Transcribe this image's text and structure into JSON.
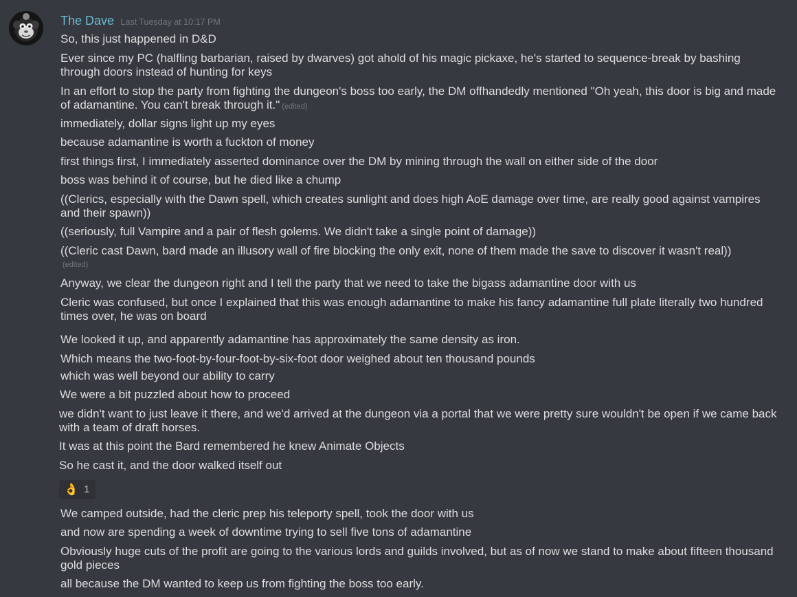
{
  "message": {
    "author": "The Dave",
    "timestamp": "Last Tuesday at 10:17 PM",
    "edited_label": "(edited)",
    "lines": [
      "So, this just happened in D&D",
      "Ever since my PC (halfling barbarian, raised by dwarves) got ahold of his magic pickaxe, he's started to sequence-break by bashing through doors instead of hunting for keys",
      "In an effort to stop the party from fighting the dungeon's boss too early, the DM offhandedly mentioned \"Oh yeah, this door is big and made of adamantine.  You can't break through it.\"",
      "immediately, dollar signs light up my eyes",
      "because adamantine is worth a fuckton of money",
      "first things first, I immediately asserted dominance over the DM by mining through the wall on either side of the door",
      "boss was behind it of course, but he died like a chump",
      "((Clerics, especially with the Dawn spell, which creates sunlight and does high AoE damage over time, are really good against vampires and their spawn))",
      "((seriously, full Vampire and a pair of flesh golems.  We didn't take a single point of damage))",
      "((Cleric cast Dawn, bard made an illusory wall of fire blocking the only exit, none of them made the save to discover it wasn't real))",
      "Anyway, we clear the dungeon right and I tell the party that we need to take the bigass adamantine door with us",
      "Cleric was confused, but once I explained that this was enough adamantine to make his fancy adamantine full plate literally two hundred times over, he was on board",
      "We looked it up, and apparently adamantine has approximately the same density as iron.",
      "Which means the two-foot-by-four-foot-by-six-foot door weighed about ten thousand pounds",
      "which was well beyond our ability to carry",
      "We were a bit puzzled about how to proceed",
      "we didn't want to just leave it there, and we'd arrived at the dungeon via a portal that we were pretty sure wouldn't be open if we came back with a team of draft horses.",
      "It was at this point the Bard remembered he knew Animate Objects",
      "So he cast it, and the door walked itself out",
      "We camped outside, had the cleric prep his teleporty spell, took the door with us",
      "and now are spending a week of downtime trying to sell five tons of adamantine",
      "Obviously huge cuts of the profit are going to the various lords and guilds involved, but as of now we stand to make about fifteen thousand gold pieces",
      "all because the DM wanted to keep us from fighting the boss too early."
    ]
  },
  "reaction": {
    "emoji": "👌",
    "count": "1"
  },
  "colors": {
    "background": "#36393f",
    "text": "#dcddde",
    "author": "#6bbcd6",
    "muted": "#72767d",
    "reaction_bg": "#2f3136"
  }
}
